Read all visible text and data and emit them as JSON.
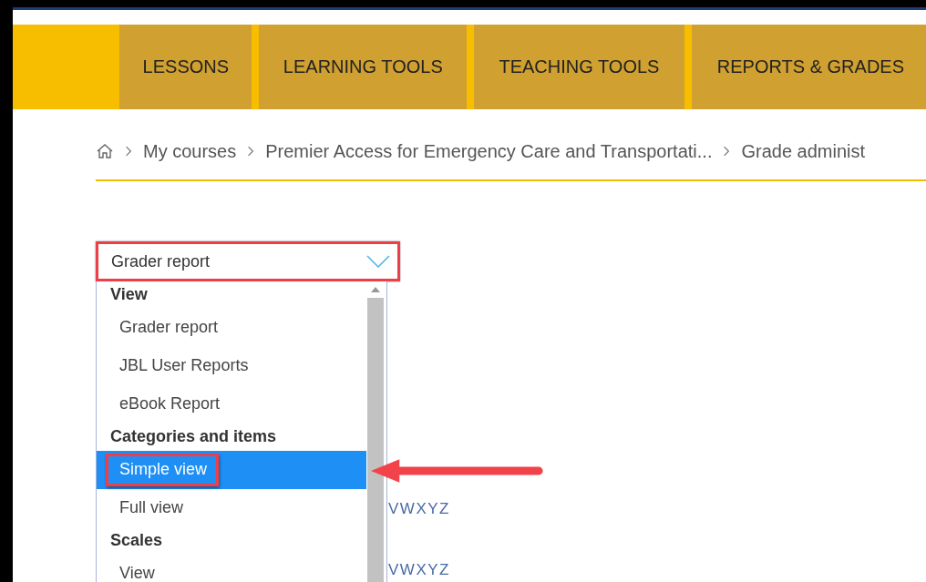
{
  "nav": {
    "tabs": [
      {
        "label": "LESSONS",
        "selected": false
      },
      {
        "label": "LEARNING TOOLS",
        "selected": false
      },
      {
        "label": "TEACHING TOOLS",
        "selected": false
      },
      {
        "label": "REPORTS & GRADES",
        "selected": false
      }
    ]
  },
  "breadcrumb": [
    "My courses",
    "Premier Access for Emergency Care and Transportati...",
    "Grade administ"
  ],
  "report_select": {
    "value": "Grader report",
    "highlighted": true,
    "expanded": true,
    "groups": [
      {
        "heading": "View",
        "options": [
          {
            "label": "Grader report",
            "selected": false,
            "highlighted": false
          },
          {
            "label": "JBL User Reports",
            "selected": false,
            "highlighted": false
          },
          {
            "label": "eBook Report",
            "selected": false,
            "highlighted": false
          }
        ]
      },
      {
        "heading": "Categories and items",
        "options": [
          {
            "label": "Simple view",
            "selected": true,
            "highlighted": true
          },
          {
            "label": "Full view",
            "selected": false,
            "highlighted": false
          }
        ]
      },
      {
        "heading": "Scales",
        "options": [
          {
            "label": "View",
            "selected": false,
            "highlighted": false
          }
        ]
      }
    ]
  },
  "letter_filters": [
    "VWXYZ",
    "VWXYZ"
  ]
}
